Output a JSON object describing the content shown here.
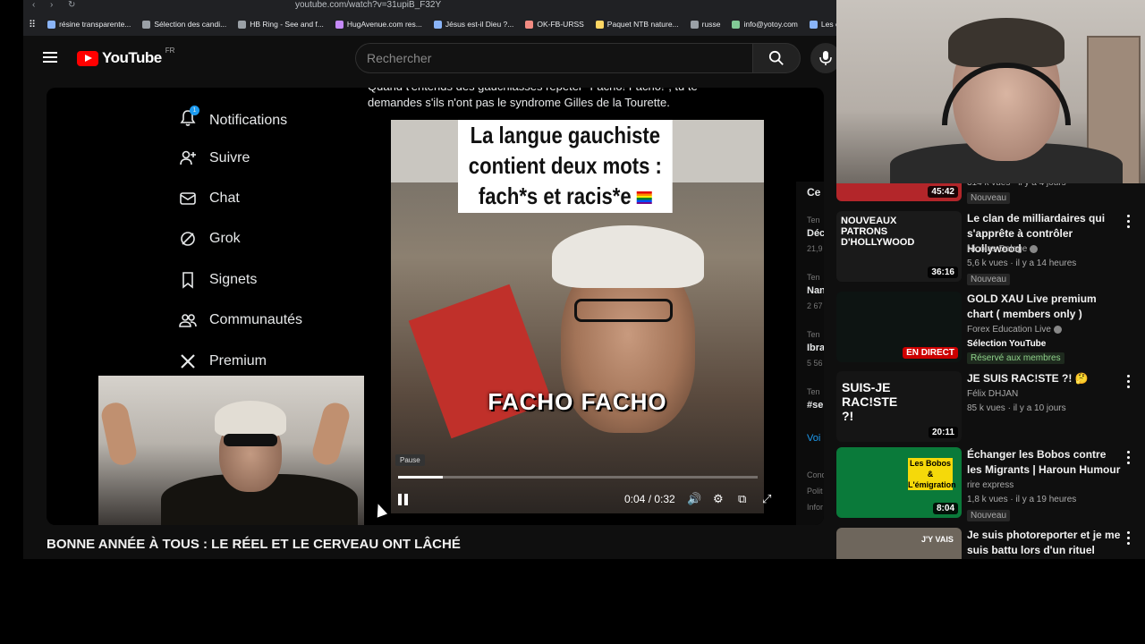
{
  "browser": {
    "url": "youtube.com/watch?v=31upiB_F32Y",
    "bookmarks": [
      {
        "label": "résine transparente...",
        "color": "#8ab4f8"
      },
      {
        "label": "Sélection des candi...",
        "color": "#9aa0a6"
      },
      {
        "label": "HB Ring - See and f...",
        "color": "#9aa0a6"
      },
      {
        "label": "HugAvenue.com res...",
        "color": "#c58af9"
      },
      {
        "label": "Jésus est-il Dieu ?...",
        "color": "#8ab4f8"
      },
      {
        "label": "OK-FB-URSS",
        "color": "#f28b82"
      },
      {
        "label": "Paquet NTB nature...",
        "color": "#fdd663"
      },
      {
        "label": "russe",
        "color": "#9aa0a6"
      },
      {
        "label": "info@yotoy.com",
        "color": "#81c995"
      },
      {
        "label": "Les concou",
        "color": "#8ab4f8"
      }
    ]
  },
  "youtube": {
    "logo_text": "YouTube",
    "region": "FR",
    "search_placeholder": "Rechercher"
  },
  "x_sidebar": {
    "notification_count": "1",
    "items": [
      {
        "label": "Notifications",
        "icon": "bell-icon"
      },
      {
        "label": "Suivre",
        "icon": "follow-icon"
      },
      {
        "label": "Chat",
        "icon": "mail-icon"
      },
      {
        "label": "Grok",
        "icon": "grok-icon"
      },
      {
        "label": "Signets",
        "icon": "bookmark-icon"
      },
      {
        "label": "Communautés",
        "icon": "people-icon"
      },
      {
        "label": "Premium",
        "icon": "x-icon"
      }
    ]
  },
  "tweet": {
    "text_line1": "Quand t'entends des gauchiasses répéter \"Facho! Facho!\", tu te",
    "text_line2": "demandes s'ils n'ont pas le syndrome Gilles de la Tourette."
  },
  "clip": {
    "caption": "La langue gauchiste contient deux mots : fach*s et racis*e",
    "overlay_text": "FACHO FACHO",
    "tooltip": "Pause",
    "time": "0:04 / 0:32",
    "progress": 0.125
  },
  "right_strip": {
    "heading": "Ce",
    "lines": [
      {
        "label": "Ten",
        "bold": "Déc",
        "sub": "21,9"
      },
      {
        "label": "Ten",
        "bold": "Nan",
        "sub": "2 67"
      },
      {
        "label": "Ten",
        "bold": "Ibra",
        "sub": "5 56"
      },
      {
        "label": "Ten",
        "bold": "#se",
        "sub": ""
      }
    ],
    "more": "Voi",
    "footer": [
      "Cond",
      "Polit",
      "Infor"
    ]
  },
  "video_title": "BONNE ANNÉE À TOUS : LE RÉEL ET LE CERVEAU ONT LÂCHÉ",
  "recommendations": [
    {
      "title": "",
      "channel": "",
      "meta": "314 k vues · il y a 4 jours",
      "badge": "Nouveau",
      "duration": "45:42",
      "thumb_color": "#b3262a"
    },
    {
      "title": "Le clan de milliardaires qui s'apprête à contrôler Hollywood",
      "channel": "Nicolas Delage",
      "meta": "5,6 k vues · il y a 14 heures",
      "badge": "Nouveau",
      "duration": "36:16",
      "thumb_color": "#1a1a1a",
      "thumb_text": "NOUVEAUX PATRONS D'HOLLYWOOD"
    },
    {
      "title": "GOLD XAU Live premium chart ( members only )",
      "channel": "Forex Education Live",
      "meta": "Sélection YouTube",
      "badge": "Réservé aux membres",
      "live": "EN DIRECT",
      "thumb_color": "#0d1412"
    },
    {
      "title": "JE SUIS RAC!STE ?! 🤔",
      "channel": "Félix DHJAN",
      "meta": "85 k vues · il y a 10 jours",
      "badge": "",
      "duration": "20:11",
      "thumb_color": "#151515",
      "thumb_text": "SUIS-JE RAC!STE ?!"
    },
    {
      "title": "Échanger les Bobos contre les Migrants | Haroun Humour",
      "channel": "rire express",
      "meta": "1,8 k vues · il y a 19 heures",
      "badge": "Nouveau",
      "duration": "8:04",
      "thumb_color": "#0a7a3a",
      "thumb_text": "Les Bobos & L'émigration"
    },
    {
      "title": "Je suis photoreporter et je me suis battu lors d'un rituel viole...",
      "channel": "",
      "meta": "",
      "badge": "",
      "thumb_color": "#6e665c",
      "thumb_text": "J'Y VAIS"
    }
  ]
}
